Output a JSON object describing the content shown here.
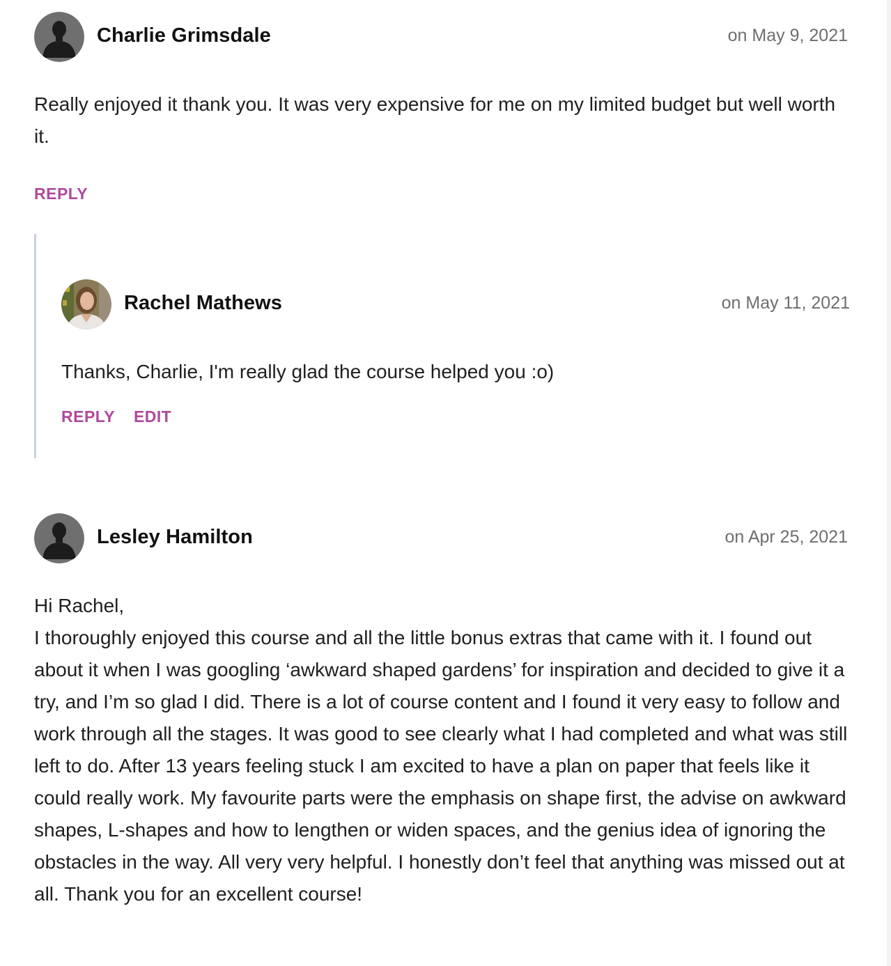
{
  "comments": [
    {
      "author": "Charlie Grimsdale",
      "date": "on May 9, 2021",
      "avatar": "default-silhouette-icon",
      "text": "Really enjoyed it thank you. It was very expensive for me on my limited budget but well worth it.",
      "actions": {
        "reply": "REPLY"
      }
    },
    {
      "author": "Rachel Mathews",
      "date": "on May 11, 2021",
      "avatar": "user-photo",
      "text": "Thanks, Charlie, I'm really glad the course helped you :o)",
      "actions": {
        "reply": "REPLY",
        "edit": "EDIT"
      }
    },
    {
      "author": "Lesley Hamilton",
      "date": "on Apr 25, 2021",
      "avatar": "default-silhouette-icon",
      "greeting": "Hi Rachel,",
      "text": "I thoroughly enjoyed this course and all the little bonus extras that came with it. I found out about it when I was googling ‘awkward shaped gardens’ for inspiration and decided to give it a try, and I’m so glad I did. There is a lot of course content and I found it very easy to follow and work through all the stages. It was good to see clearly what I had completed and what was still left to do. After 13 years feeling stuck I am excited to have a plan on paper that feels like it could really work. My favourite parts were the emphasis on shape first, the advise on awkward shapes, L-shapes and how to lengthen or widen spaces, and the genius idea of ignoring the obstacles in the way. All very very helpful. I honestly don’t feel that anything was missed out at all. Thank you for an excellent course!"
    }
  ],
  "colors": {
    "action_link": "#b0499d",
    "date_text": "#6e6e6e",
    "thread_line": "#c9cfe3"
  }
}
